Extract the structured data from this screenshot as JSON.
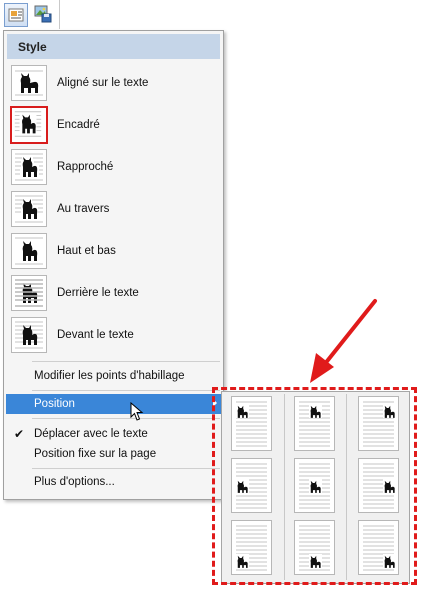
{
  "menu": {
    "header": "Style",
    "styles": [
      {
        "label": "Aligné sur le texte",
        "icon": "inline-cat-icon"
      },
      {
        "label": "Encadré",
        "icon": "square-cat-icon",
        "selected": true
      },
      {
        "label": "Rapproché",
        "icon": "tight-cat-icon"
      },
      {
        "label": "Au travers",
        "icon": "through-cat-icon"
      },
      {
        "label": "Haut et bas",
        "icon": "top-bottom-cat-icon"
      },
      {
        "label": "Derrière le texte",
        "icon": "behind-text-cat-icon"
      },
      {
        "label": "Devant le texte",
        "icon": "front-text-cat-icon"
      }
    ],
    "edit_wrap": "Modifier les points d'habillage",
    "position": "Position",
    "move_with_text": "Déplacer avec le texte",
    "move_with_text_checked": true,
    "fix_position": "Position fixe sur la page",
    "more_options": "Plus d'options..."
  },
  "accent": "#3a86d8",
  "highlight_color": "#d81c1c"
}
